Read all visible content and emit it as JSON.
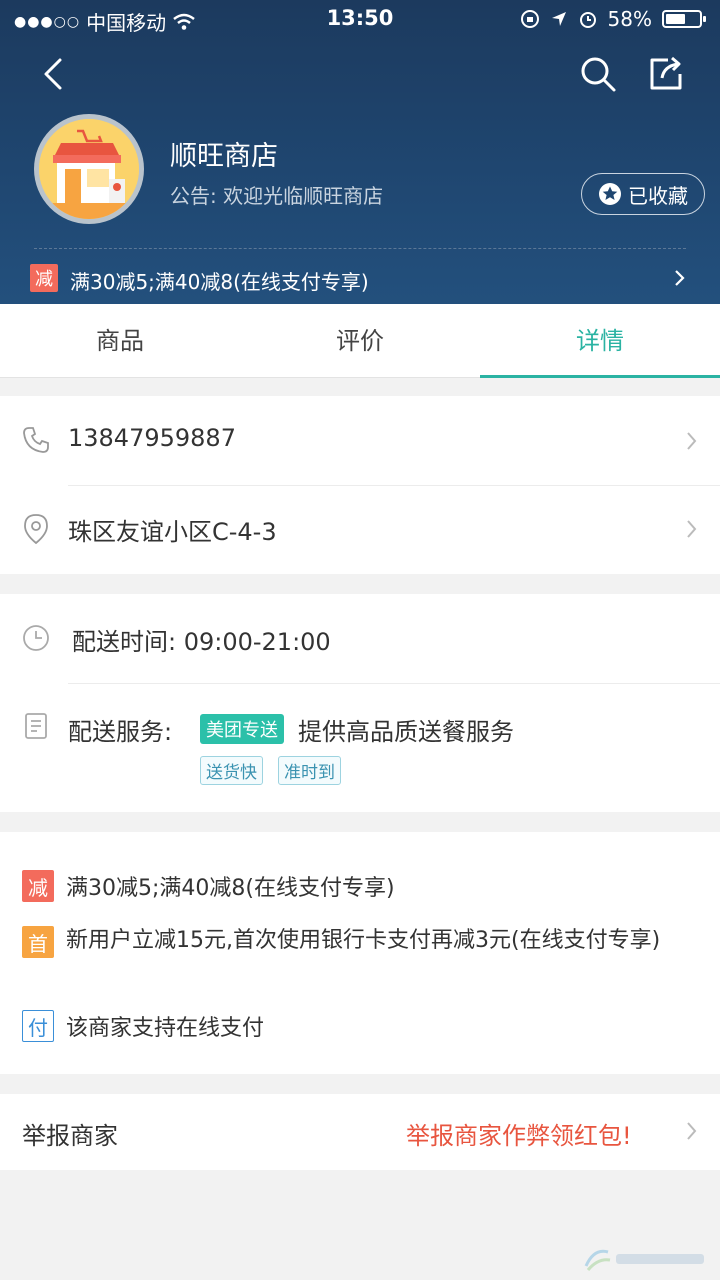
{
  "status_bar": {
    "carrier": "中国移动",
    "time": "13:50",
    "battery": "58%",
    "battery_level": 0.58
  },
  "shop": {
    "name": "顺旺商店",
    "notice": "公告: 欢迎光临顺旺商店",
    "favorite_label": "已收藏",
    "promo_tag": "减",
    "promo_text": "满30减5;满40减8(在线支付专享)"
  },
  "tabs": [
    {
      "label": "商品"
    },
    {
      "label": "评价"
    },
    {
      "label": "详情"
    }
  ],
  "contact": {
    "phone": "13847959887",
    "address": "珠区友谊小区C-4-3"
  },
  "delivery": {
    "time_label": "配送时间: 09:00-21:00",
    "service_label": "配送服务:",
    "service_badge": "美团专送",
    "service_desc": "提供高品质送餐服务",
    "service_tags": [
      "送货快",
      "准时到"
    ]
  },
  "promotions": [
    {
      "tag": "减",
      "color": "#f36b5c",
      "text": "满30减5;满40减8(在线支付专享)"
    },
    {
      "tag": "首",
      "color": "#f7a441",
      "text": "新用户立减15元,首次使用银行卡支付再减3元(在线支付专享)"
    },
    {
      "tag": "付",
      "color": "#3a8fd8",
      "text": "该商家支持在线支付"
    }
  ],
  "report": {
    "label": "举报商家",
    "hint": "举报商家作弊领红包!"
  },
  "colors": {
    "accent": "#2bb3a3",
    "header": "#1f4670",
    "report_hint": "#e8553f"
  }
}
